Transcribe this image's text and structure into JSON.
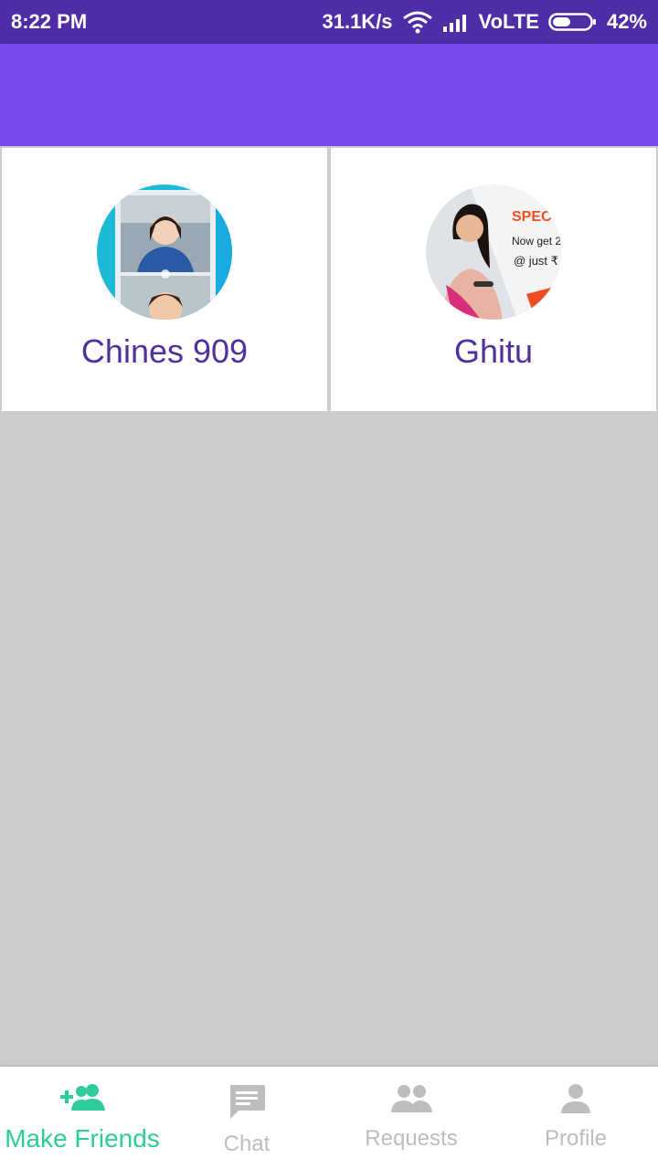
{
  "status_bar": {
    "time": "8:22 PM",
    "network_speed": "31.1K/s",
    "network_type": "VoLTE",
    "battery": "42%",
    "icons": [
      "wifi-icon",
      "signal-icon",
      "battery-icon"
    ]
  },
  "app_bar": {
    "title": ""
  },
  "friends": [
    {
      "name": "Chines 909",
      "avatar": "photo-couple-selfie"
    },
    {
      "name": "Ghitu",
      "avatar": "photo-woman-ad",
      "avatar_text": [
        "SPEC",
        "Now get 2",
        "@ just ₹"
      ]
    }
  ],
  "bottom_nav": {
    "items": [
      {
        "label": "Make Friends",
        "icon": "add-friends-icon",
        "active": true
      },
      {
        "label": "Chat",
        "icon": "chat-icon",
        "active": false
      },
      {
        "label": "Requests",
        "icon": "requests-icon",
        "active": false
      },
      {
        "label": "Profile",
        "icon": "profile-icon",
        "active": false
      }
    ]
  },
  "colors": {
    "status_bar": "#4e2da6",
    "app_bar": "#774cef",
    "accent": "#2ecc9a",
    "name_text": "#50309f",
    "inactive": "#bdbdbd",
    "background": "#cccccc"
  }
}
